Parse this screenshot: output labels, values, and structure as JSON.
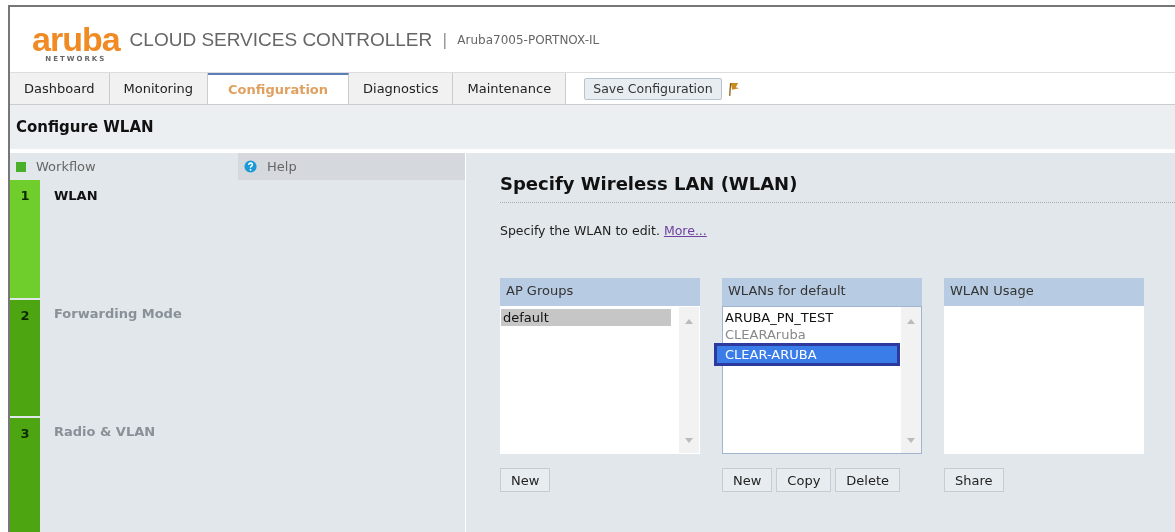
{
  "header": {
    "logo": {
      "wordmark": "aruba",
      "tagline": "NETWORKS"
    },
    "product": "CLOUD SERVICES CONTROLLER",
    "separator": "|",
    "device": "Aruba7005-PORTNOX-IL"
  },
  "tabs": [
    {
      "label": "Dashboard",
      "selected": false
    },
    {
      "label": "Monitoring",
      "selected": false
    },
    {
      "label": "Configuration",
      "selected": true
    },
    {
      "label": "Diagnostics",
      "selected": false
    },
    {
      "label": "Maintenance",
      "selected": false
    }
  ],
  "save_button": "Save Configuration",
  "page_title": "Configure WLAN",
  "panel_tabs": {
    "workflow": "Workflow",
    "help": "Help"
  },
  "steps": [
    {
      "number": "1",
      "label": "WLAN",
      "selected": true
    },
    {
      "number": "2",
      "label": "Forwarding Mode",
      "selected": false
    },
    {
      "number": "3",
      "label": "Radio & VLAN",
      "selected": false
    }
  ],
  "section_title": "Specify Wireless LAN (WLAN)",
  "intro": {
    "text": "Specify the WLAN to edit.",
    "link": "More..."
  },
  "lists": [
    {
      "title": "AP Groups",
      "scrollbar": true,
      "focused": false,
      "items": [
        {
          "label": "default",
          "selected": true,
          "disabled": false
        }
      ],
      "buttons": [
        "New"
      ]
    },
    {
      "title": "WLANs for default",
      "scrollbar": true,
      "focused": true,
      "items": [
        {
          "label": "ARUBA_PN_TEST",
          "selected": false,
          "disabled": false
        },
        {
          "label": "CLEARAruba",
          "selected": false,
          "disabled": true
        },
        {
          "label": "CLEAR-ARUBA",
          "selected": true,
          "disabled": false
        }
      ],
      "buttons": [
        "New",
        "Copy",
        "Delete"
      ]
    },
    {
      "title": "WLAN Usage",
      "scrollbar": false,
      "focused": false,
      "buttons": [
        "Share"
      ]
    }
  ]
}
